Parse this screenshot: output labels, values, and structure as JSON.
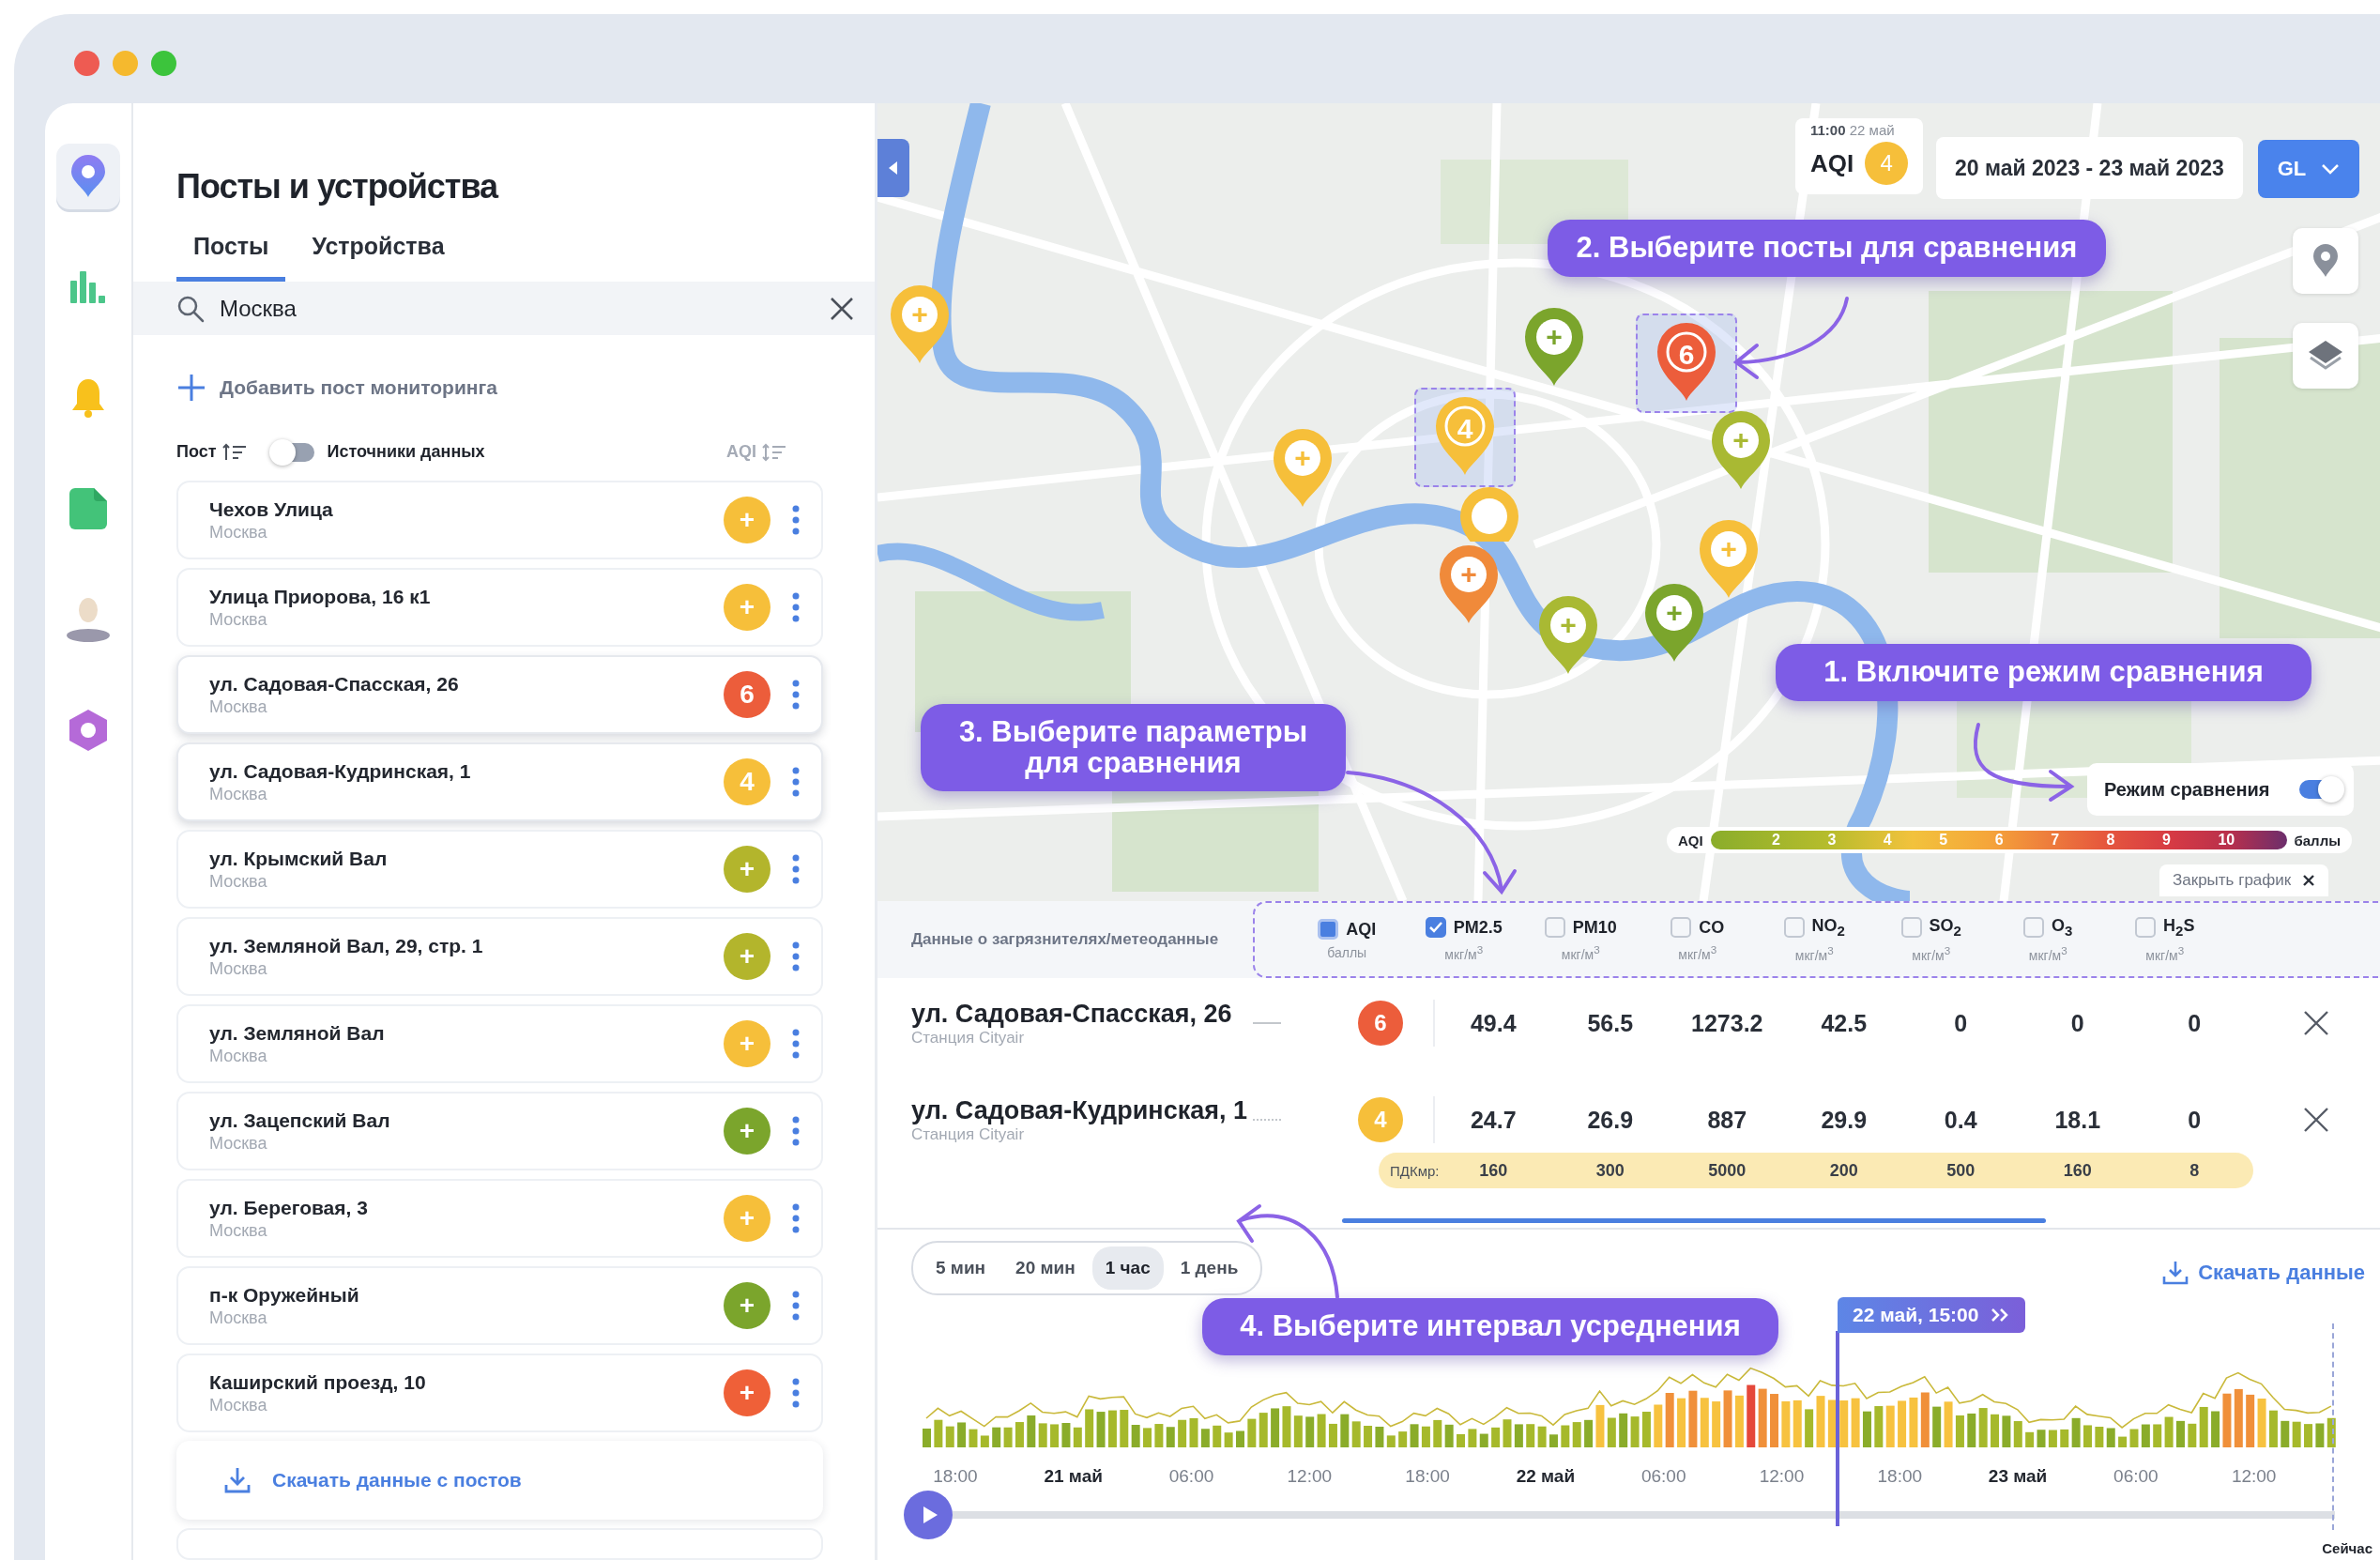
{
  "nav": [
    {
      "kind": "map",
      "selected": true
    },
    {
      "kind": "stats",
      "selected": false
    },
    {
      "kind": "alerts",
      "selected": false
    },
    {
      "kind": "reports",
      "selected": false
    },
    {
      "kind": "profile",
      "selected": false
    },
    {
      "kind": "settings",
      "selected": false
    }
  ],
  "panel": {
    "title": "Посты и устройства",
    "tabs": [
      {
        "label": "Посты",
        "selected": true
      },
      {
        "label": "Устройства",
        "selected": false
      }
    ],
    "search": {
      "value": "Москва"
    },
    "add_label": "Добавить пост мониторинга",
    "sort": {
      "post_label": "Пост",
      "sources_label": "Источники данных",
      "sources_on": false,
      "aqi_label": "AQI"
    },
    "posts": [
      {
        "name": "Чехов Улица",
        "city": "Москва",
        "badge": "+",
        "color": "#f6bf3a",
        "selected": false
      },
      {
        "name": "Улица Приорова, 16 к1",
        "city": "Москва",
        "badge": "+",
        "color": "#f6bf3a",
        "selected": false
      },
      {
        "name": "ул. Садовая-Спасская, 26",
        "city": "Москва",
        "badge": "6",
        "color": "#ec5d3b",
        "selected": true
      },
      {
        "name": "ул. Садовая-Кудринская, 1",
        "city": "Москва",
        "badge": "4",
        "color": "#f6bf3a",
        "selected": true
      },
      {
        "name": "ул. Крымский Вал",
        "city": "Москва",
        "badge": "+",
        "color": "#b3b52c",
        "selected": false
      },
      {
        "name": "ул. Земляной Вал, 29, стр. 1",
        "city": "Москва",
        "badge": "+",
        "color": "#b3b52c",
        "selected": false
      },
      {
        "name": "ул. Земляной Вал",
        "city": "Москва",
        "badge": "+",
        "color": "#f6bf3a",
        "selected": false
      },
      {
        "name": "ул. Зацепский Вал",
        "city": "Москва",
        "badge": "+",
        "color": "#7ba52c",
        "selected": false
      },
      {
        "name": "ул. Береговая, 3",
        "city": "Москва",
        "badge": "+",
        "color": "#f6bf3a",
        "selected": false
      },
      {
        "name": "п-к Оружейный",
        "city": "Москва",
        "badge": "+",
        "color": "#7ba52c",
        "selected": false
      },
      {
        "name": "Каширский проезд, 10",
        "city": "Москва",
        "badge": "+",
        "color": "#ef6038",
        "selected": false
      }
    ],
    "download_label": "Скачать данные с постов"
  },
  "map": {
    "aqi_time": "11:00",
    "aqi_date": "22 май",
    "aqi_label": "AQI",
    "aqi_value": "4",
    "date_range": "20 май 2023 - 23 май 2023",
    "layer_button": "GL",
    "pins": [
      {
        "label": "+",
        "kind": "add",
        "color": "#f6bf3a",
        "selected": false
      },
      {
        "label": "+",
        "kind": "add",
        "color": "#7ba52c",
        "selected": false
      },
      {
        "label": "6",
        "kind": "value",
        "color": "#ec5d3b",
        "selected": true
      },
      {
        "label": "4",
        "kind": "value",
        "color": "#f6bf3a",
        "selected": true
      },
      {
        "label": "+",
        "kind": "add",
        "color": "#f6bf3a",
        "selected": false
      },
      {
        "label": "+",
        "kind": "add",
        "color": "#a9b933",
        "selected": false
      },
      {
        "kind": "add",
        "color": "#f6bf3a",
        "selected": false
      },
      {
        "label": "+",
        "kind": "add",
        "color": "#f08a3a",
        "selected": false
      },
      {
        "label": "+",
        "kind": "add",
        "color": "#f6bf3a",
        "selected": false
      },
      {
        "label": "+",
        "kind": "add",
        "color": "#a9b933",
        "selected": false
      },
      {
        "label": "+",
        "kind": "add",
        "color": "#7ba52c",
        "selected": false
      }
    ],
    "compare": {
      "label": "Режим сравнения",
      "on": true
    },
    "legend": {
      "label": "AQI",
      "steps": [
        "2",
        "3",
        "4",
        "5",
        "6",
        "7",
        "8",
        "9",
        "10"
      ],
      "unit": "баллы"
    },
    "close_chart": "Закрыть график"
  },
  "callouts": [
    "1. Включите режим сравнения",
    "2. Выберите посты для сравнения",
    "3. Выберите параметры для сравнения",
    "4. Выберите интервал усреднения"
  ],
  "table": {
    "label": "Данные о загрязнителях/метеоданные",
    "params": [
      {
        "name": "AQI",
        "unit": "баллы",
        "kind": "index",
        "checked": true
      },
      {
        "name": "PM2.5",
        "unit": "мкг/м$^{3}$",
        "kind": "pollutant",
        "checked": true
      },
      {
        "name": "PM10",
        "unit": "мкг/м$^{3}$",
        "kind": "pollutant",
        "checked": false
      },
      {
        "name": "CO",
        "unit": "мкг/м$^{3}$",
        "kind": "pollutant",
        "checked": false
      },
      {
        "name": "NO$_{2}$",
        "unit": "мкг/м$^{3}$",
        "kind": "pollutant",
        "checked": false
      },
      {
        "name": "SO$_{2}$",
        "unit": "мкг/м$^{3}$",
        "kind": "pollutant",
        "checked": false
      },
      {
        "name": "O$_{3}$",
        "unit": "мкг/м$^{3}$",
        "kind": "pollutant",
        "checked": false
      },
      {
        "name": "H$_{2}$S",
        "unit": "мкг/м$^{3}$",
        "kind": "pollutant",
        "checked": false
      }
    ],
    "rows": [
      {
        "name": "ул. Садовая-Спасская, 26",
        "source": "Станция Cityair",
        "dotted": false,
        "aqi": "6",
        "color": "#ec5d3b",
        "values": [
          "49.4",
          "56.5",
          "1273.2",
          "42.5",
          "0",
          "0",
          "0"
        ]
      },
      {
        "name": "ул. Садовая-Кудринская, 1",
        "source": "Станция Cityair",
        "dotted": true,
        "aqi": "4",
        "color": "#f6bf3a",
        "values": [
          "24.7",
          "26.9",
          "887",
          "29.9",
          "0.4",
          "18.1",
          "0"
        ]
      }
    ],
    "limits": {
      "label": "ПДКмр:",
      "values": [
        "160",
        "300",
        "5000",
        "200",
        "500",
        "160",
        "8"
      ]
    }
  },
  "timeline": {
    "intervals": [
      {
        "label": "5 мин",
        "selected": false
      },
      {
        "label": "20 мин",
        "selected": false
      },
      {
        "label": "1 час",
        "selected": true
      },
      {
        "label": "1 день",
        "selected": false
      }
    ],
    "download": "Скачать данные",
    "cursor": "22 май, 15:00",
    "ticks": [
      {
        "label": "18:00",
        "kind": "time"
      },
      {
        "label": "21 май",
        "kind": "day"
      },
      {
        "label": "06:00",
        "kind": "time"
      },
      {
        "label": "12:00",
        "kind": "time"
      },
      {
        "label": "18:00",
        "kind": "time"
      },
      {
        "label": "22 май",
        "kind": "day"
      },
      {
        "label": "06:00",
        "kind": "time"
      },
      {
        "label": "12:00",
        "kind": "time"
      },
      {
        "label": "18:00",
        "kind": "time"
      },
      {
        "label": "23 май",
        "kind": "day"
      },
      {
        "label": "06:00",
        "kind": "time"
      },
      {
        "label": "12:00",
        "kind": "time"
      }
    ],
    "now": "Сейчас"
  }
}
